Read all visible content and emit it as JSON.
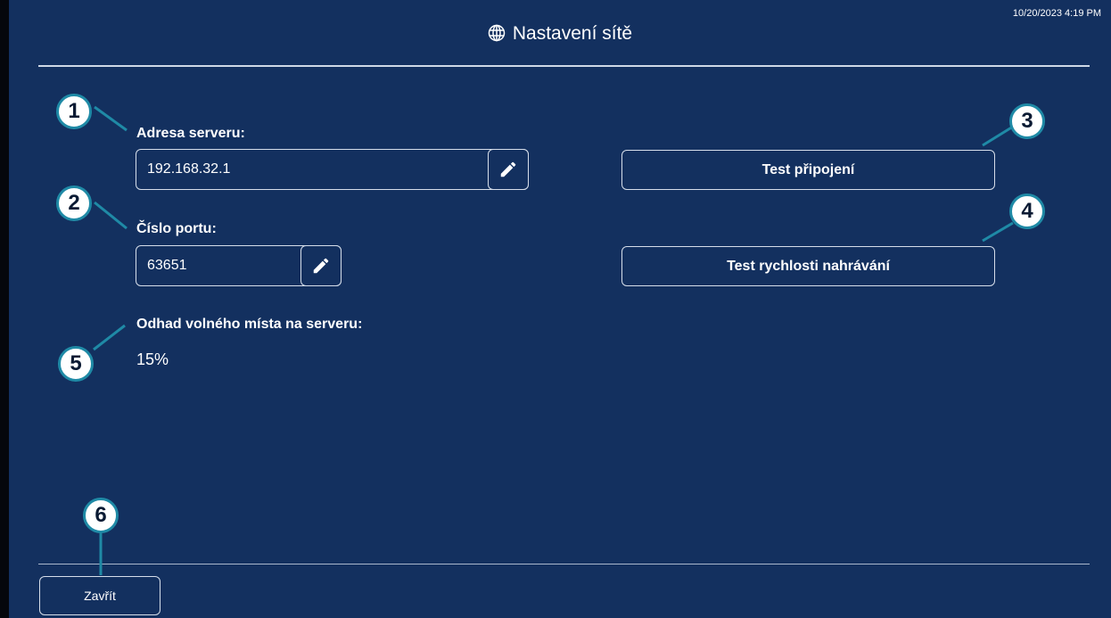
{
  "header": {
    "datetime": "10/20/2023 4:19 PM",
    "icon": "globe-icon",
    "title": "Nastavení sítě"
  },
  "server_address": {
    "label": "Adresa serveru:",
    "value": "192.168.32.1",
    "edit_icon": "pencil-icon"
  },
  "port": {
    "label": "Číslo portu:",
    "value": "63651",
    "edit_icon": "pencil-icon"
  },
  "buttons": {
    "test_connection": "Test připojení",
    "test_upload_speed": "Test rychlosti nahrávání",
    "close": "Zavřít"
  },
  "free_space": {
    "label": "Odhad volného místa na serveru:",
    "value": "15%"
  },
  "callouts": [
    "1",
    "2",
    "3",
    "4",
    "5",
    "6"
  ],
  "colors": {
    "background": "#13305f",
    "callout_border": "#1f8aa6",
    "text": "#ffffff"
  }
}
